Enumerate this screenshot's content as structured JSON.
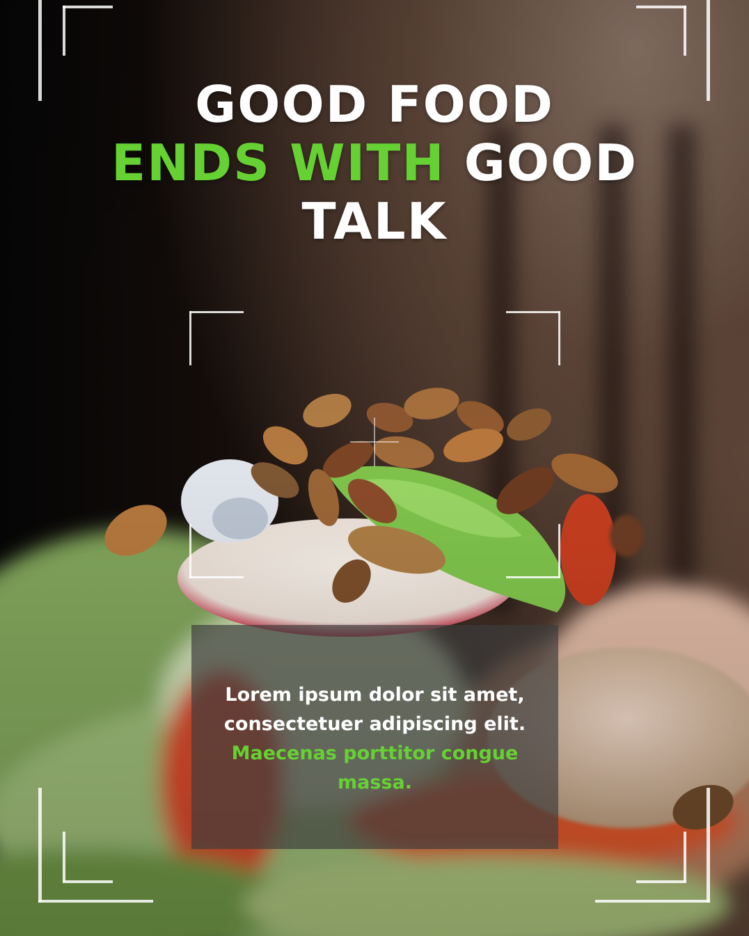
{
  "headline": {
    "line1": "GOOD FOOD",
    "line2_highlight": "ENDS WITH",
    "line2_rest": "GOOD",
    "line3": "TALK"
  },
  "body": {
    "line1": "Lorem ipsum dolor sit amet,",
    "line2": "consectetuer adipiscing elit.",
    "line3": "Maecenas porttitor congue",
    "line4": "massa."
  },
  "colors": {
    "accent_green": "#66d133",
    "text_white": "#ffffff",
    "textbox_bg": "rgba(60,60,60,0.68)"
  }
}
